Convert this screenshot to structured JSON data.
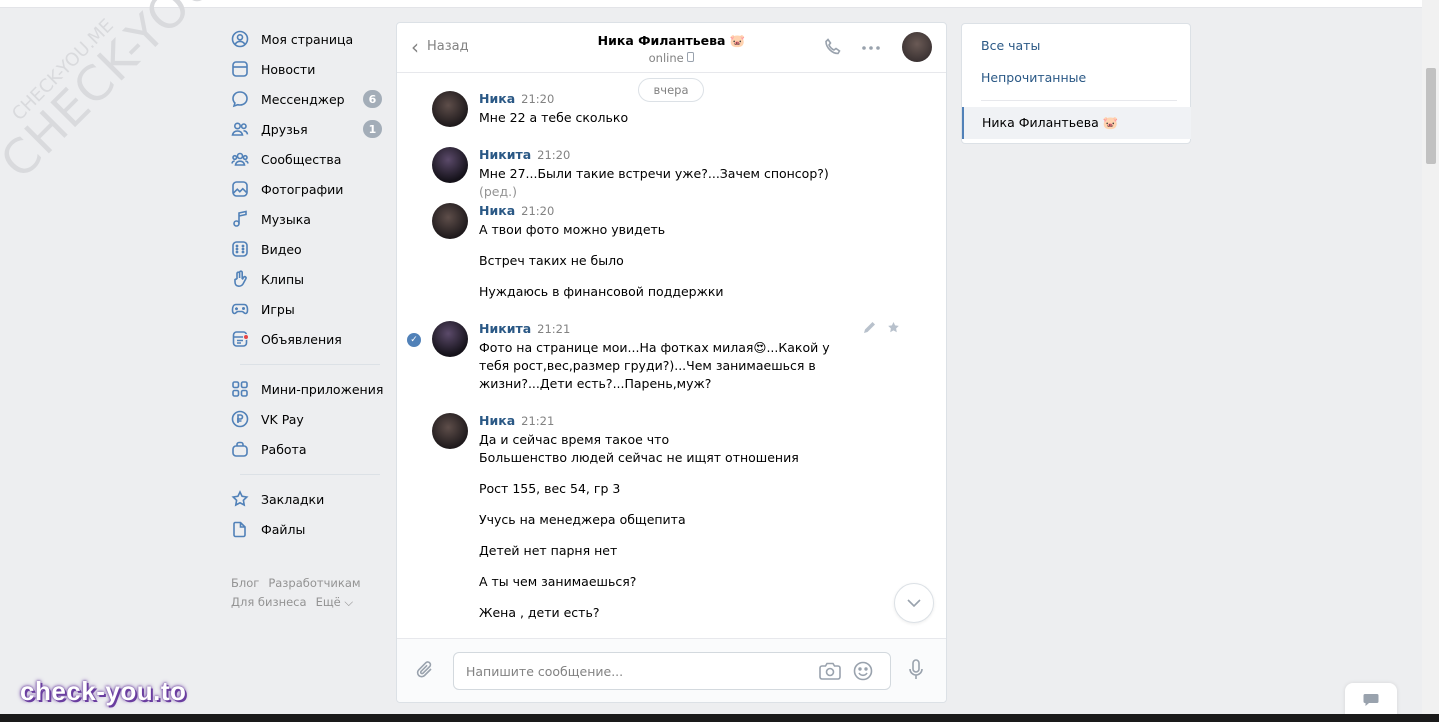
{
  "watermark": {
    "big": "CHECK-YOU.ME",
    "small": "CHECK-YOU.ME",
    "logo": "check-you.to"
  },
  "sidebar": {
    "items": [
      {
        "label": "Моя страница",
        "icon": "user-circle-icon"
      },
      {
        "label": "Новости",
        "icon": "news-icon"
      },
      {
        "label": "Мессенджер",
        "icon": "message-icon",
        "badge": "6"
      },
      {
        "label": "Друзья",
        "icon": "friends-icon",
        "badge": "1"
      },
      {
        "label": "Сообщества",
        "icon": "communities-icon"
      },
      {
        "label": "Фотографии",
        "icon": "photo-icon"
      },
      {
        "label": "Музыка",
        "icon": "music-icon"
      },
      {
        "label": "Видео",
        "icon": "video-icon"
      },
      {
        "label": "Клипы",
        "icon": "clips-icon"
      },
      {
        "label": "Игры",
        "icon": "games-icon"
      },
      {
        "label": "Объявления",
        "icon": "ads-icon"
      }
    ],
    "items2": [
      {
        "label": "Мини-приложения",
        "icon": "apps-icon"
      },
      {
        "label": "VK Pay",
        "icon": "vkpay-icon"
      },
      {
        "label": "Работа",
        "icon": "work-icon"
      }
    ],
    "items3": [
      {
        "label": "Закладки",
        "icon": "bookmark-icon"
      },
      {
        "label": "Файлы",
        "icon": "file-icon"
      }
    ],
    "footer": {
      "blog": "Блог",
      "dev": "Разработчикам",
      "business": "Для бизнеса",
      "more": "Ещё ⌵"
    }
  },
  "chat": {
    "back": "Назад",
    "peer_name": "Ника Филантьева 🐷",
    "peer_status": "online",
    "date_pill": "вчера",
    "messages": [
      {
        "author": "Ника",
        "time": "21:20",
        "paras": [
          "Мне 22 а тебе сколько"
        ]
      },
      {
        "author": "Никита",
        "time": "21:20",
        "paras": [
          "Мне 27...Были такие встречи уже?...Зачем спонсор?)"
        ],
        "edited": "(ред.)"
      },
      {
        "author": "Ника",
        "time": "21:20",
        "paras": [
          "А твои фото можно увидеть",
          "Встреч таких не было",
          "Нуждаюсь в финансовой поддержки"
        ]
      },
      {
        "author": "Никита",
        "time": "21:21",
        "paras": [
          "Фото на странице мои...На фотках милая😍...Какой у тебя рост,вес,размер груди?)...Чем занимаешься в жизни?...Дети есть?...Парень,муж?"
        ]
      },
      {
        "author": "Ника",
        "time": "21:21",
        "paras": [
          "Да и сейчас время такое что\nБольшенство людей сейчас не ищят отношения",
          "Рост 155, вес 54, гр 3",
          "Учусь на менеджера общепита",
          "Детей нет парня нет",
          "А ты чем занимаешься?",
          "Жена , дети есть?"
        ]
      }
    ],
    "composer_placeholder": "Напишите сообщение..."
  },
  "right_panel": {
    "all_chats": "Все чаты",
    "unread": "Непрочитанные",
    "active_chat": "Ника Филантьева 🐷"
  }
}
